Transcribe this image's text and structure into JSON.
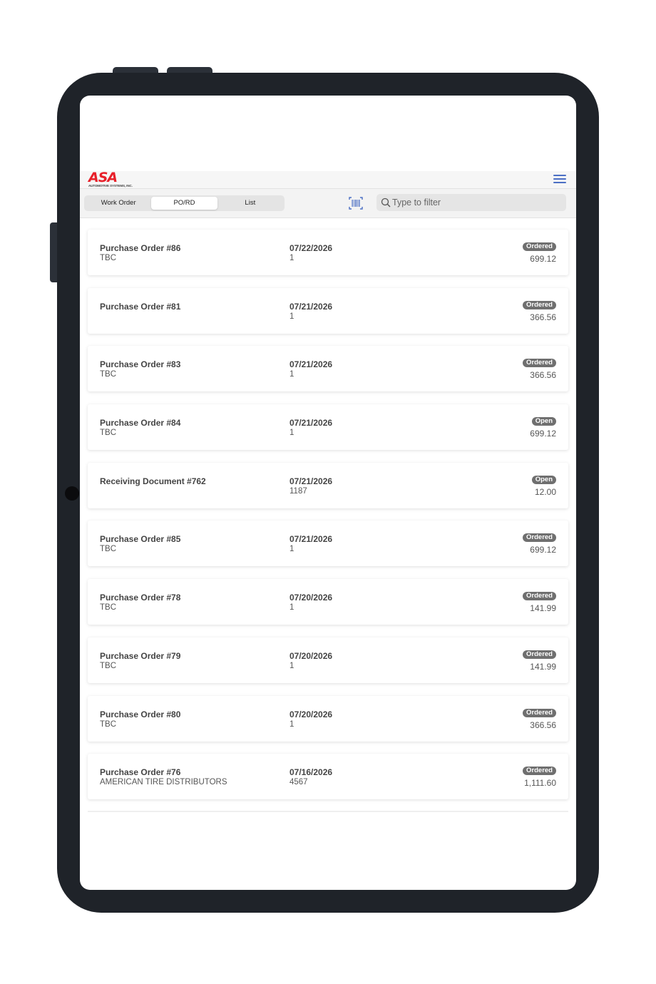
{
  "header": {
    "logo_text": "ASA",
    "logo_subtext": "AUTOMOTIVE SYSTEMS, INC.",
    "menu_icon": "hamburger-menu-icon"
  },
  "tabs": [
    {
      "label": "Work Order",
      "active": false
    },
    {
      "label": "PO/RD",
      "active": true
    },
    {
      "label": "List",
      "active": false
    }
  ],
  "scan_icon": "barcode-scan-icon",
  "search": {
    "placeholder": "Type to filter",
    "value": ""
  },
  "colors": {
    "brand": "#e8202a",
    "accent": "#4b6fc4",
    "badge": "#6f6f6f"
  },
  "orders": [
    {
      "title": "Purchase Order #86",
      "vendor": "TBC",
      "date": "07/22/2026",
      "ref": "1",
      "status": "Ordered",
      "amount": "699.12"
    },
    {
      "title": "Purchase Order #81",
      "vendor": "",
      "date": "07/21/2026",
      "ref": "1",
      "status": "Ordered",
      "amount": "366.56"
    },
    {
      "title": "Purchase Order #83",
      "vendor": "TBC",
      "date": "07/21/2026",
      "ref": "1",
      "status": "Ordered",
      "amount": "366.56"
    },
    {
      "title": "Purchase Order #84",
      "vendor": "TBC",
      "date": "07/21/2026",
      "ref": "1",
      "status": "Open",
      "amount": "699.12"
    },
    {
      "title": "Receiving Document #762",
      "vendor": "",
      "date": "07/21/2026",
      "ref": "1187",
      "status": "Open",
      "amount": "12.00"
    },
    {
      "title": "Purchase Order #85",
      "vendor": "TBC",
      "date": "07/21/2026",
      "ref": "1",
      "status": "Ordered",
      "amount": "699.12"
    },
    {
      "title": "Purchase Order #78",
      "vendor": "TBC",
      "date": "07/20/2026",
      "ref": "1",
      "status": "Ordered",
      "amount": "141.99"
    },
    {
      "title": "Purchase Order #79",
      "vendor": "TBC",
      "date": "07/20/2026",
      "ref": "1",
      "status": "Ordered",
      "amount": "141.99"
    },
    {
      "title": "Purchase Order #80",
      "vendor": "TBC",
      "date": "07/20/2026",
      "ref": "1",
      "status": "Ordered",
      "amount": "366.56"
    },
    {
      "title": "Purchase Order #76",
      "vendor": "AMERICAN TIRE DISTRIBUTORS",
      "date": "07/16/2026",
      "ref": "4567",
      "status": "Ordered",
      "amount": "1,111.60"
    }
  ]
}
